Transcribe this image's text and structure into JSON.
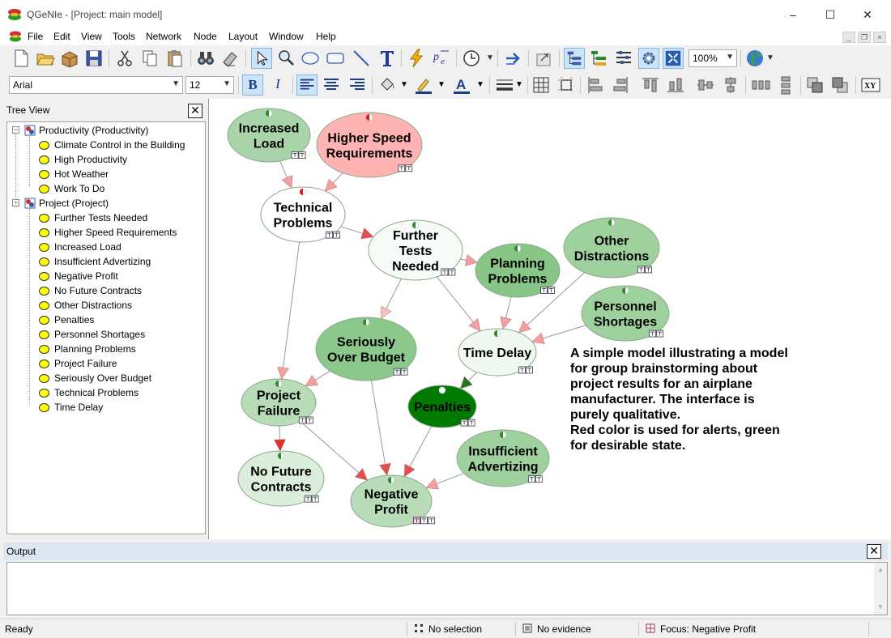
{
  "window": {
    "title": "QGeNIe - [Project: main model]",
    "controls": {
      "minimize": "–",
      "maximize": "☐",
      "close": "✕"
    }
  },
  "menu": {
    "items": [
      "File",
      "Edit",
      "View",
      "Tools",
      "Network",
      "Node",
      "Layout",
      "Window",
      "Help"
    ]
  },
  "toolbar": {
    "zoom": "100%",
    "font": "Arial",
    "font_size": "12",
    "bold_label": "B",
    "italic_label": "I"
  },
  "tree": {
    "title": "Tree View",
    "close_label": "✕",
    "networks": [
      {
        "label": "Productivity (Productivity)",
        "expander": "−",
        "children": [
          "Climate Control in the Building",
          "High Productivity",
          "Hot Weather",
          "Work To Do"
        ]
      },
      {
        "label": "Project (Project)",
        "expander": "−",
        "children": [
          "Further Tests Needed",
          "Higher Speed Requirements",
          "Increased Load",
          "Insufficient Advertizing",
          "Negative Profit",
          "No Future Contracts",
          "Other Distractions",
          "Penalties",
          "Personnel Shortages",
          "Planning Problems",
          "Project Failure",
          "Seriously Over Budget",
          "Technical Problems",
          "Time Delay"
        ]
      }
    ]
  },
  "graph": {
    "nodes": [
      {
        "id": "increased-load",
        "lines": [
          "Increased",
          "Load"
        ],
        "fill": "#a9d4a9",
        "indicator": "#2e8b2e"
      },
      {
        "id": "higher-speed",
        "lines": [
          "Higher Speed",
          "Requirements"
        ],
        "fill": "#ffb3b3",
        "indicator": "#d92020"
      },
      {
        "id": "technical-problems",
        "lines": [
          "Technical",
          "Problems"
        ],
        "fill": "#ffffff",
        "indicator": "#d92020"
      },
      {
        "id": "further-tests",
        "lines": [
          "Further",
          "Tests",
          "Needed"
        ],
        "fill": "#f7fbf7",
        "indicator": "#2e8b2e"
      },
      {
        "id": "planning-problems",
        "lines": [
          "Planning",
          "Problems"
        ],
        "fill": "#87c687",
        "indicator": "#2e8b2e"
      },
      {
        "id": "other-distractions",
        "lines": [
          "Other",
          "Distractions"
        ],
        "fill": "#9fd19f",
        "indicator": "#2e8b2e"
      },
      {
        "id": "personnel-shortages",
        "lines": [
          "Personnel",
          "Shortages"
        ],
        "fill": "#9fd19f",
        "indicator": "#2e8b2e"
      },
      {
        "id": "seriously-over-budget",
        "lines": [
          "Seriously",
          "Over Budget"
        ],
        "fill": "#8cc88c",
        "indicator": "#2e8b2e"
      },
      {
        "id": "time-delay",
        "lines": [
          "Time Delay"
        ],
        "fill": "#f1f8f1",
        "indicator": "#2e8b2e"
      },
      {
        "id": "project-failure",
        "lines": [
          "Project",
          "Failure"
        ],
        "fill": "#b7dcb7",
        "indicator": "#2e8b2e"
      },
      {
        "id": "penalties",
        "lines": [
          "Penalties"
        ],
        "fill": "#007a00",
        "indicator": "#ffffff"
      },
      {
        "id": "insufficient-advertizing",
        "lines": [
          "Insufficient",
          "Advertizing"
        ],
        "fill": "#9fd19f",
        "indicator": "#2e8b2e"
      },
      {
        "id": "no-future-contracts",
        "lines": [
          "No Future",
          "Contracts"
        ],
        "fill": "#dbeedb",
        "indicator": "#2e8b2e"
      },
      {
        "id": "negative-profit",
        "lines": [
          "Negative",
          "Profit"
        ],
        "fill": "#b7dcb7",
        "indicator": "#2e8b2e"
      }
    ],
    "note": [
      "A simple model illustrating a model",
      "for group brainstorming about",
      "project results for an airplane",
      "manufacturer. The interface is",
      "purely qualitative.",
      "Red color is used for alerts, green",
      "for desirable state."
    ]
  },
  "output": {
    "title": "Output",
    "close_label": "✕"
  },
  "status": {
    "ready": "Ready",
    "selection": "No selection",
    "evidence": "No evidence",
    "focus": "Focus: Negative Profit"
  }
}
